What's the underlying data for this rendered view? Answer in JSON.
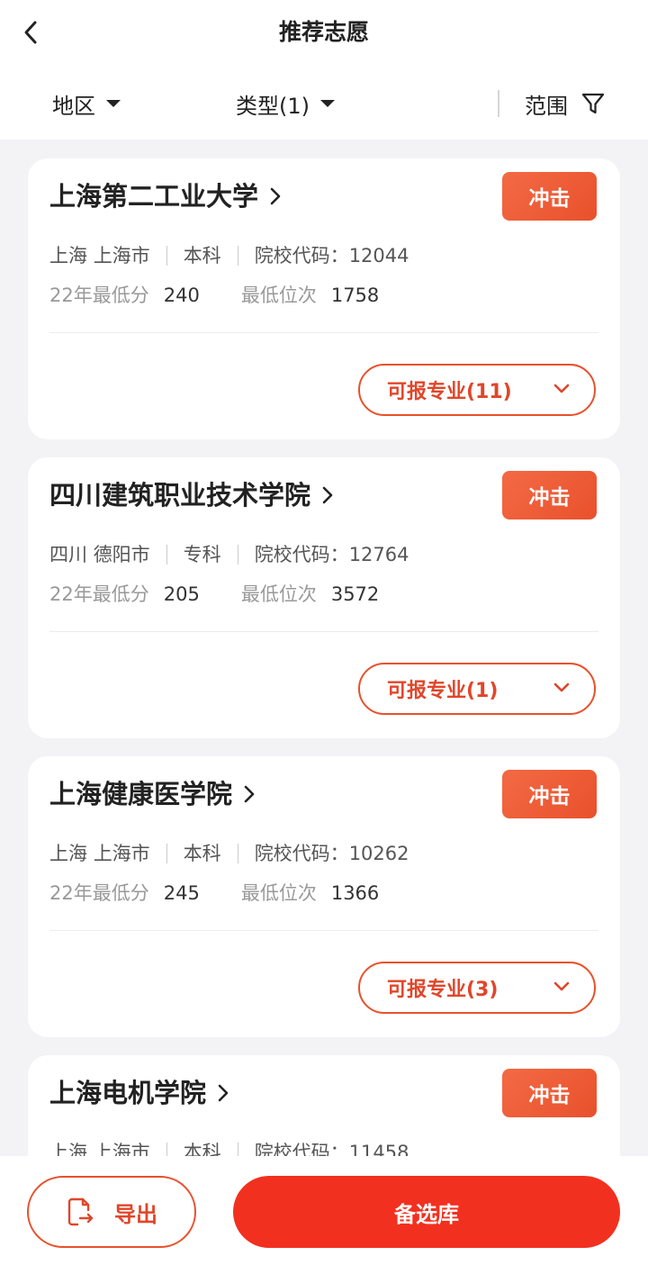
{
  "header": {
    "title": "推荐志愿",
    "back_icon": "chevron-left-icon"
  },
  "filters": {
    "region": "地区",
    "type": "类型(1)",
    "range": "范围",
    "range_icon": "filter-funnel-icon"
  },
  "cards": [
    {
      "name": "上海第二工业大学",
      "badge": "冲击",
      "province": "上海",
      "city": "上海市",
      "level": "本科",
      "code_label": "院校代码：",
      "code": "12044",
      "min_score_label": "22年最低分",
      "min_score": "240",
      "min_rank_label": "最低位次",
      "min_rank": "1758",
      "majors_label": "可报专业(11)"
    },
    {
      "name": "四川建筑职业技术学院",
      "badge": "冲击",
      "province": "四川",
      "city": "德阳市",
      "level": "专科",
      "code_label": "院校代码：",
      "code": "12764",
      "min_score_label": "22年最低分",
      "min_score": "205",
      "min_rank_label": "最低位次",
      "min_rank": "3572",
      "majors_label": "可报专业(1)"
    },
    {
      "name": "上海健康医学院",
      "badge": "冲击",
      "province": "上海",
      "city": "上海市",
      "level": "本科",
      "code_label": "院校代码：",
      "code": "10262",
      "min_score_label": "22年最低分",
      "min_score": "245",
      "min_rank_label": "最低位次",
      "min_rank": "1366",
      "majors_label": "可报专业(3)"
    },
    {
      "name": "上海电机学院",
      "badge": "冲击",
      "province": "上海",
      "city": "上海市",
      "level": "本科",
      "code_label": "院校代码：",
      "code": "11458"
    }
  ],
  "bottom": {
    "export_label": "导出",
    "export_icon": "file-export-icon",
    "candidate_label": "备选库"
  },
  "colors": {
    "accent": "#e8512c",
    "primary_button": "#f2301f",
    "background": "#f3f3f5"
  }
}
